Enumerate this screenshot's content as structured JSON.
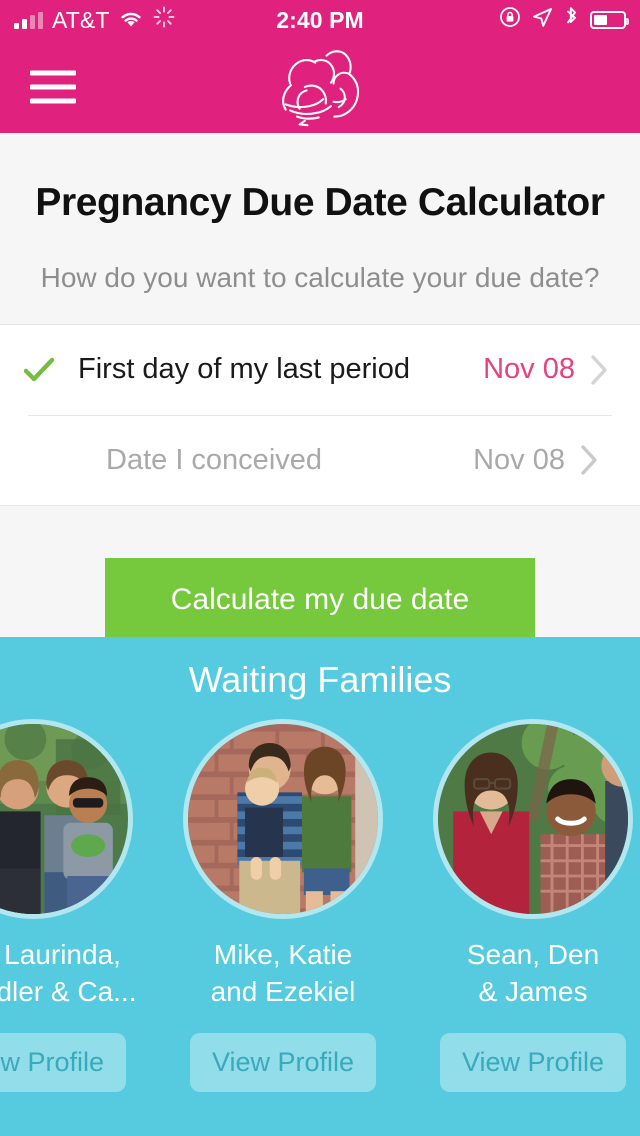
{
  "statusbar": {
    "carrier": "AT&T",
    "time": "2:40 PM",
    "wifi_icon": "wifi-icon",
    "activity_icon": "activity-spinner-icon",
    "rotation_lock_icon": "rotation-lock-icon",
    "location_icon": "location-arrow-icon",
    "bluetooth_icon": "bluetooth-icon",
    "battery_icon": "battery-icon"
  },
  "navbar": {
    "menu_label": "menu",
    "logo_alt": "mother and baby line art logo",
    "background": "#e0217d"
  },
  "header": {
    "title": "Pregnancy Due Date Calculator",
    "subtitle": "How do you want to calculate your due date?"
  },
  "options": [
    {
      "label": "First day of my last period",
      "date": "Nov 08",
      "selected": true,
      "chevron": "chevron-right-icon"
    },
    {
      "label": "Date I conceived",
      "date": "Nov 08",
      "selected": false,
      "chevron": "chevron-right-icon"
    }
  ],
  "cta": {
    "label": "Calculate my due date",
    "color": "#76c83d"
  },
  "families": {
    "title": "Waiting Families",
    "background": "#56cbdf",
    "cards": [
      {
        "name": "Jim, Laurinda,\nChandler & Ca...",
        "button_label": "View Profile",
        "photo_alt": "family of four outdoors"
      },
      {
        "name": "Mike, Katie\nand Ezekiel",
        "button_label": "View Profile",
        "photo_alt": "couple holding toddler by brick wall"
      },
      {
        "name": "Sean, Den\n& James",
        "button_label": "View Profile",
        "photo_alt": "woman with glasses and child outdoors"
      }
    ]
  },
  "colors": {
    "brand_pink": "#e0217d",
    "accent_pink": "#e8417f",
    "green": "#76c83d",
    "check_green": "#76bc43",
    "cyan": "#56cbdf",
    "page_bg": "#f6f6f6"
  }
}
